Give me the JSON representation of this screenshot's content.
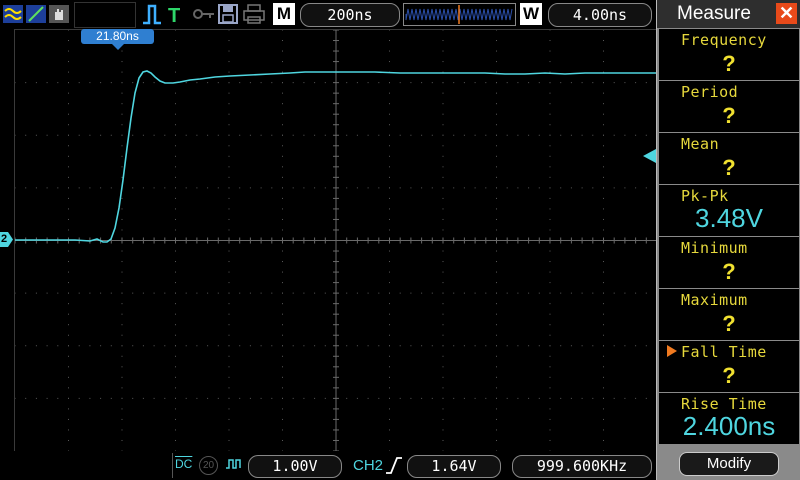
{
  "topbar": {
    "mode_letter": "M",
    "timebase": "200ns",
    "window_letter": "W",
    "window_time": "4.00ns",
    "icons": [
      "waveform-icon",
      "line-icon",
      "hand-icon",
      "pulse-trigger-icon",
      "trigger-T-icon",
      "key-icon",
      "save-icon",
      "print-icon"
    ]
  },
  "screen": {
    "cursor_label": "21.80ns",
    "channel_marker": "2"
  },
  "bottombar": {
    "coupling": "DC",
    "bandwidth": "20",
    "volts_per_div": "1.00V",
    "trigger_source": "CH2",
    "trigger_level": "1.64V",
    "frequency": "999.600KHz"
  },
  "panel": {
    "title": "Measure",
    "modify_label": "Modify",
    "items": [
      {
        "label": "Frequency",
        "value": "?"
      },
      {
        "label": "Period",
        "value": "?"
      },
      {
        "label": "Mean",
        "value": "?"
      },
      {
        "label": "Pk-Pk",
        "value": "3.48V"
      },
      {
        "label": "Minimum",
        "value": "?"
      },
      {
        "label": "Maximum",
        "value": "?"
      },
      {
        "label": "Fall Time",
        "value": "?",
        "selected": true
      },
      {
        "label": "Rise Time",
        "value": "2.400ns"
      }
    ]
  },
  "colors": {
    "trace": "#4fd6e0",
    "label": "#e6d83c",
    "accent": "#f07a20"
  }
}
